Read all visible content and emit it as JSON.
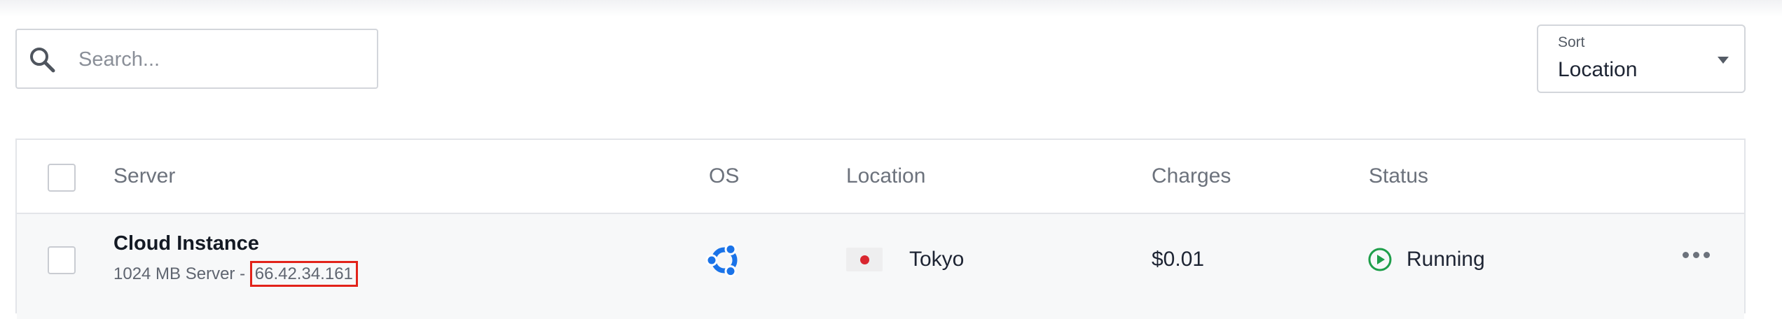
{
  "search": {
    "placeholder": "Search..."
  },
  "sort": {
    "label": "Sort",
    "value": "Location"
  },
  "table": {
    "columns": [
      "Server",
      "OS",
      "Location",
      "Charges",
      "Status"
    ],
    "rows": [
      {
        "name": "Cloud Instance",
        "details": "1024 MB Server - ",
        "ip": "66.42.34.161",
        "os_icon": "ubuntu-icon",
        "location": "Tokyo",
        "flag": "japan-flag",
        "charges": "$0.01",
        "status": "Running",
        "status_icon": "play-circle-icon"
      }
    ]
  },
  "colors": {
    "ubuntu": "#1a73e8",
    "running": "#1e9e4a",
    "highlight": "#e2231a"
  }
}
